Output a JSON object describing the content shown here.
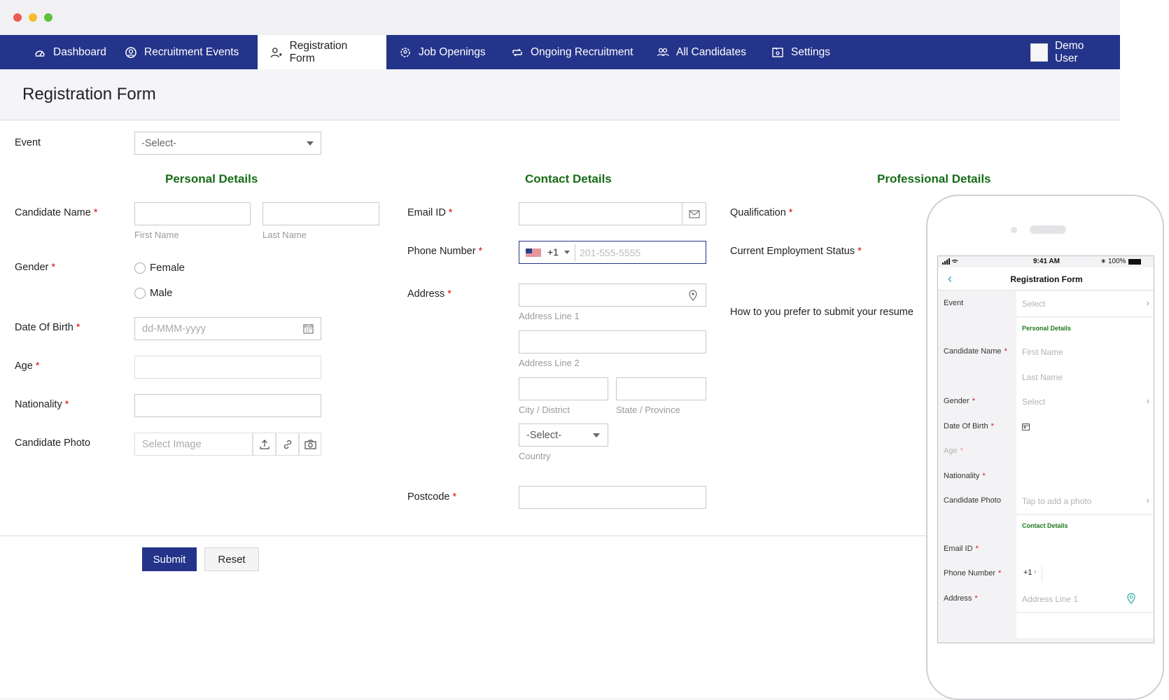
{
  "nav": {
    "items": [
      {
        "label": "Dashboard",
        "icon": "dashboard-icon"
      },
      {
        "label": "Recruitment Events",
        "icon": "recruitment-events-icon"
      },
      {
        "label": "Registration Form",
        "icon": "add-user-icon"
      },
      {
        "label": "Job Openings",
        "icon": "gear-people-icon"
      },
      {
        "label": "Ongoing Recruitment",
        "icon": "cycle-icon"
      },
      {
        "label": "All Candidates",
        "icon": "users-icon"
      },
      {
        "label": "Settings",
        "icon": "settings-folder-icon"
      }
    ],
    "user": "Demo User"
  },
  "page_title": "Registration Form",
  "form": {
    "event_label": "Event",
    "event_value": "-Select-",
    "sections": {
      "personal": "Personal Details",
      "contact": "Contact Details",
      "professional": "Professional Details"
    },
    "candidate_name": {
      "label": "Candidate Name",
      "first": "First Name",
      "last": "Last Name"
    },
    "gender": {
      "label": "Gender",
      "options": [
        "Female",
        "Male"
      ]
    },
    "dob": {
      "label": "Date Of Birth",
      "placeholder": "dd-MMM-yyyy"
    },
    "age": {
      "label": "Age"
    },
    "nationality": {
      "label": "Nationality"
    },
    "photo": {
      "label": "Candidate Photo",
      "placeholder": "Select Image"
    },
    "email": {
      "label": "Email ID"
    },
    "phone": {
      "label": "Phone Number",
      "code": "+1",
      "placeholder": "201-555-5555"
    },
    "address": {
      "label": "Address",
      "line1": "Address Line 1",
      "line2": "Address Line 2",
      "city": "City / District",
      "state": "State / Province",
      "country_value": "-Select-",
      "country": "Country"
    },
    "postcode": {
      "label": "Postcode"
    },
    "qualification": {
      "label": "Qualification"
    },
    "employment": {
      "label": "Current Employment Status"
    },
    "resume": {
      "label": "How to you prefer to submit your resume"
    },
    "required_mark": "*"
  },
  "buttons": {
    "submit": "Submit",
    "reset": "Reset"
  },
  "mobile": {
    "time": "9:41 AM",
    "battery": "100%",
    "title": "Registration Form",
    "event": "Event",
    "select": "Select",
    "personal": "Personal Details",
    "candidate_name": "Candidate Name",
    "first_name": "First Name",
    "last_name": "Last Name",
    "gender": "Gender",
    "dob": "Date Of Birth",
    "age": "Age",
    "nationality": "Nationality",
    "photo": "Candidate Photo",
    "photo_ph": "Tap to add a photo",
    "contact": "Contact Details",
    "email": "Email ID",
    "phone": "Phone Number",
    "phone_code": "+1",
    "address": "Address",
    "address_line1": "Address Line 1"
  },
  "colors": {
    "nav": "#24348a",
    "section": "#166b16",
    "required": "#d21010",
    "submit": "#24348a"
  }
}
